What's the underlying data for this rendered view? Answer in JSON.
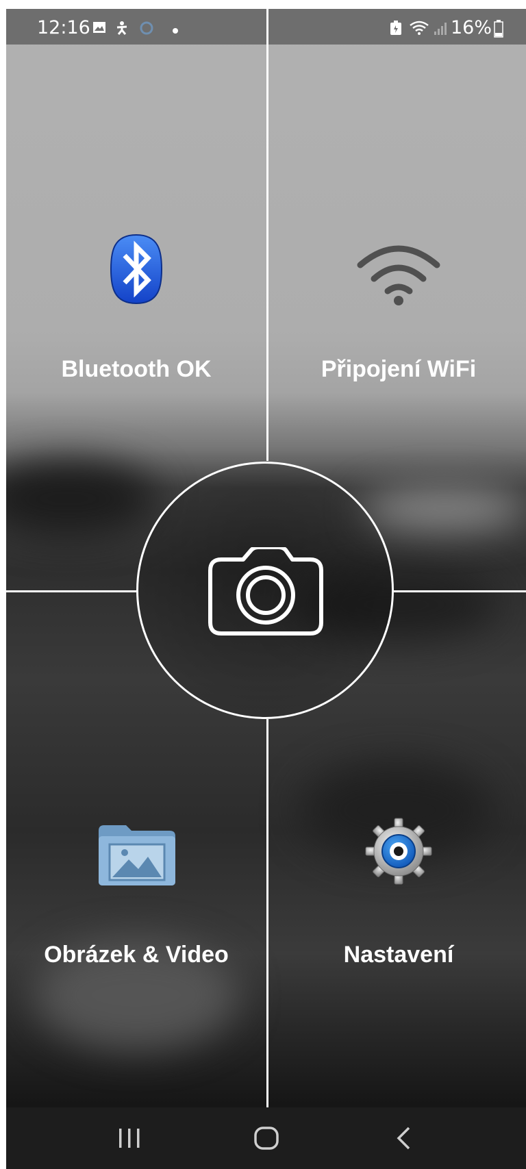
{
  "status_bar": {
    "time": "12:16",
    "battery": "16%"
  },
  "tiles": {
    "bluetooth": {
      "label": "Bluetooth OK",
      "icon": "bluetooth-icon"
    },
    "wifi": {
      "label": "Připojení WiFi",
      "icon": "wifi-icon"
    },
    "gallery": {
      "label": "Obrázek & Video",
      "icon": "image-folder-icon"
    },
    "settings": {
      "label": "Nastavení",
      "icon": "gear-icon"
    }
  },
  "center": {
    "icon": "camera-icon"
  },
  "nav_bar": {
    "recents": "recents-icon",
    "home": "home-icon",
    "back": "back-icon"
  },
  "colors": {
    "bluetooth_blue": "#1f5fe0",
    "status_bar_bg": "#6e6e6e",
    "line_color": "#ffffff"
  }
}
